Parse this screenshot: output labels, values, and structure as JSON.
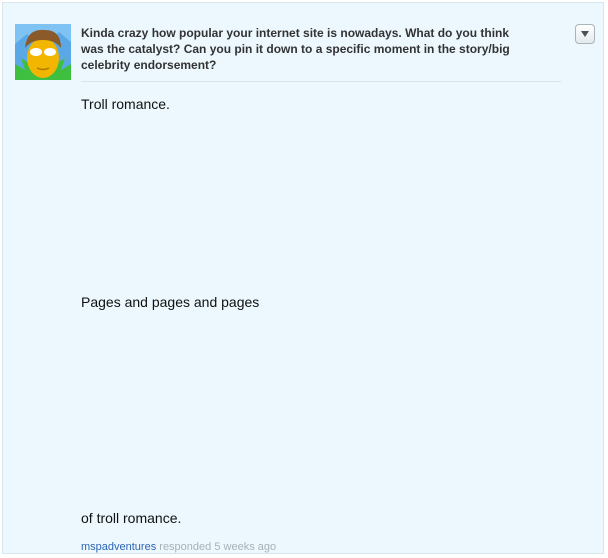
{
  "question": {
    "text": "Kinda crazy how popular your internet site is nowadays. What do you think was the catalyst? Can you pin it down to a specific moment in the story/big celebrity endorsement?"
  },
  "answer": {
    "line1": "Troll romance.",
    "line2": "Pages and pages and pages",
    "line3": "of troll romance."
  },
  "footer": {
    "username": "mspadventures",
    "action": "responded",
    "time": "5 weeks ago"
  },
  "colors": {
    "card_background": "#ecf8fe",
    "link": "#2d64b3",
    "meta_text": "#a7b0b6"
  },
  "icons": {
    "menu": "triangle-down-icon",
    "avatar": "user-avatar"
  }
}
